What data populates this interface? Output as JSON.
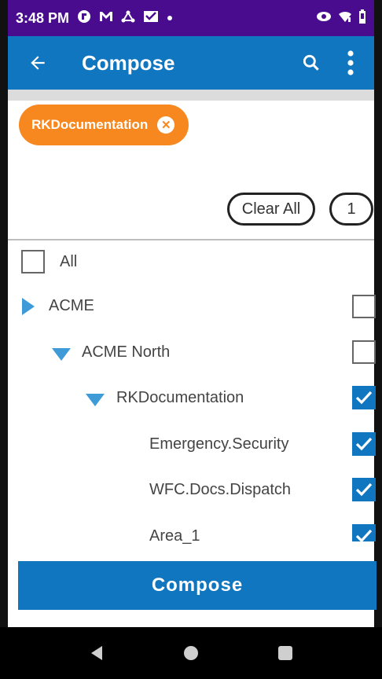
{
  "status_bar": {
    "time": "3:48 PM",
    "icons": [
      "notification-icon",
      "gmail-icon",
      "share-icon",
      "inbox-icon",
      "dot-icon"
    ],
    "right_icons": [
      "eye-icon",
      "wifi-icon",
      "battery-icon"
    ]
  },
  "app_bar": {
    "title": "Compose",
    "back_icon": "arrow-back-icon",
    "search_icon": "search-icon",
    "more_icon": "more-vert-icon"
  },
  "selected_chip": {
    "label": "RKDocumentation",
    "remove_icon": "close-circle-icon"
  },
  "actions": {
    "clear_all_label": "Clear All",
    "selected_count": "1"
  },
  "tree": {
    "all_label": "All",
    "items": [
      {
        "label": "ACME",
        "level": 0,
        "expander": "collapsed",
        "checked": false
      },
      {
        "label": "ACME North",
        "level": 1,
        "expander": "expanded",
        "checked": false
      },
      {
        "label": "RKDocumentation",
        "level": 2,
        "expander": "expanded",
        "checked": true
      },
      {
        "label": "Emergency.Security",
        "level": 3,
        "expander": "none",
        "checked": true
      },
      {
        "label": "WFC.Docs.Dispatch",
        "level": 3,
        "expander": "none",
        "checked": true
      },
      {
        "label": "Area_1",
        "level": 3,
        "expander": "none",
        "checked": true
      }
    ]
  },
  "compose_button": {
    "label": "Compose"
  },
  "colors": {
    "status_bar": "#4a0c8f",
    "app_bar": "#0f76bf",
    "chip": "#f7881f",
    "checkbox_checked": "#0f76bf",
    "expander": "#3e9bd8"
  }
}
